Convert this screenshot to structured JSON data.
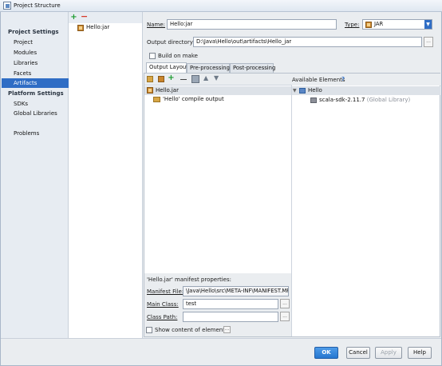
{
  "window": {
    "title": "Project Structure"
  },
  "nav": {
    "project_settings": "Project Settings",
    "items": [
      "Project",
      "Modules",
      "Libraries",
      "Facets",
      "Artifacts"
    ],
    "platform_settings": "Platform Settings",
    "platform_items": [
      "SDKs",
      "Global Libraries"
    ],
    "problems": "Problems",
    "selected": "Artifacts"
  },
  "artifacts": {
    "list": [
      "Hello:jar"
    ],
    "add_icon": "plus-icon",
    "remove_icon": "minus-icon"
  },
  "form": {
    "name_label": "Name:",
    "name_value": "Hello:jar",
    "type_label": "Type:",
    "type_value": "JAR",
    "output_dir_label": "Output directory:",
    "output_dir_value": "D:\\Java\\Hello\\out\\artifacts\\Hello_jar",
    "build_on_make": "Build on make"
  },
  "tabs": [
    "Output Layout",
    "Pre-processing",
    "Post-processing"
  ],
  "layout": {
    "root": "Hello.jar",
    "child": "'Hello' compile output"
  },
  "available": {
    "title": "Available Elements",
    "help_icon": "?",
    "root": "Hello",
    "child_name": "scala-sdk-2.11.7",
    "child_suffix": " (Global Library)"
  },
  "manifest": {
    "title": "'Hello.jar' manifest properties:",
    "file_label": "Manifest File:",
    "file_value": "\\Java\\Hello\\src\\META-INF\\MANIFEST.MF",
    "main_class_label": "Main Class:",
    "main_class_value": "test",
    "class_path_label": "Class Path:",
    "class_path_value": "",
    "show_content": "Show content of elements",
    "browse": "..."
  },
  "buttons": {
    "ok": "OK",
    "cancel": "Cancel",
    "apply": "Apply",
    "help": "Help"
  }
}
